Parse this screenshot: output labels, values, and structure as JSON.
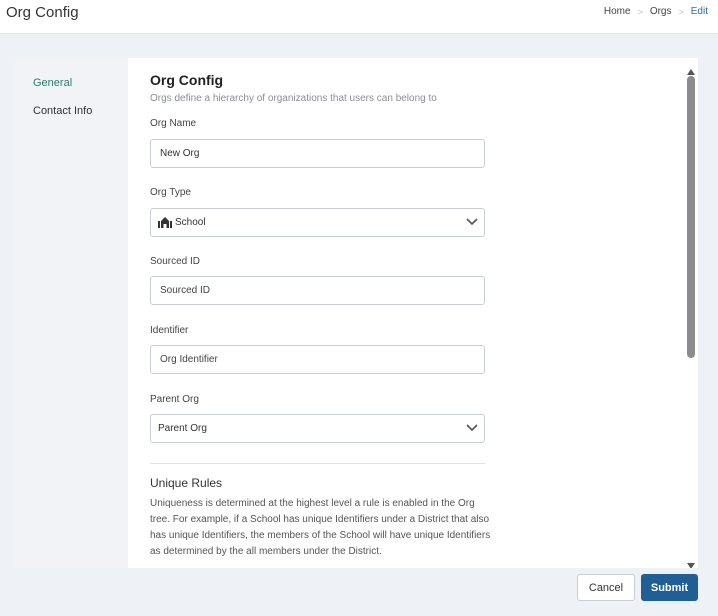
{
  "header": {
    "title": "Org Config",
    "breadcrumb": [
      "Home",
      "Orgs",
      "Edit"
    ]
  },
  "sidebar": {
    "items": [
      {
        "label": "General",
        "active": true
      },
      {
        "label": "Contact Info",
        "active": false
      }
    ]
  },
  "form": {
    "title": "Org Config",
    "subtitle": "Orgs define a hierarchy of organizations that users can belong to",
    "org_name": {
      "label": "Org Name",
      "value": "New Org"
    },
    "org_type": {
      "label": "Org Type",
      "value": "School",
      "icon": "school-icon"
    },
    "sourced_id": {
      "label": "Sourced ID",
      "placeholder": "Sourced ID"
    },
    "identifier": {
      "label": "Identifier",
      "placeholder": "Org Identifier"
    },
    "parent_org": {
      "label": "Parent Org",
      "value": "Parent Org"
    },
    "unique_rules": {
      "title": "Unique Rules",
      "body": "Uniqueness is determined at the highest level a rule is enabled in the Org tree. For example, if a School has unique Identifiers under a District that also has unique Identifiers, the members of the School will have unique Identifiers as determined by the all members under the District."
    }
  },
  "actions": {
    "cancel_label": "Cancel",
    "submit_label": "Submit"
  },
  "colors": {
    "accent": "#1f5f96",
    "active_nav": "#2c7a6e",
    "breadcrumb_active": "#2e6ea6"
  }
}
